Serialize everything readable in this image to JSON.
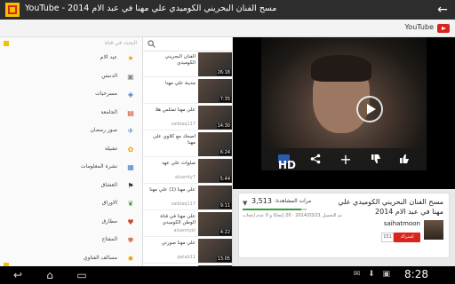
{
  "titlebar": {
    "title": "YouTube - مسح الفنان البحريني الكوميدي علي مهنا في عبد الام 2014",
    "back_icon": "arrow-back-icon"
  },
  "actionbar": {
    "label": "YouTube",
    "icon": "youtube-logo-icon",
    "brand_color": "#d9261c"
  },
  "sidebar": {
    "search_hint": "البحث في قناة",
    "items": [
      {
        "label": "عيد الام",
        "icon": "star-icon",
        "color": "#e6a400"
      },
      {
        "label": "الدنبس",
        "icon": "tv-icon",
        "color": "#888888"
      },
      {
        "label": "مسرحيات",
        "icon": "theater-icon",
        "color": "#4a7bc8"
      },
      {
        "label": "الجامعة",
        "icon": "building-icon",
        "color": "#c8452d"
      },
      {
        "label": "صور رمضان",
        "icon": "plane-icon",
        "color": "#4a7bc8"
      },
      {
        "label": "تشيلة",
        "icon": "flower-icon",
        "color": "#e6a400"
      },
      {
        "label": "نشرة المعلومات",
        "icon": "news-icon",
        "color": "#4a7bc8"
      },
      {
        "label": "العشاق",
        "icon": "heart-flag-icon",
        "color": "#333333"
      },
      {
        "label": "الاوراق",
        "icon": "leaf-icon",
        "color": "#3a9d3a"
      },
      {
        "label": "مطارق",
        "icon": "heart-icon",
        "color": "#c8452d"
      },
      {
        "label": "المفتاح",
        "icon": "flower-red-icon",
        "color": "#c8452d"
      },
      {
        "label": "مسالف الفتاوي",
        "icon": "sun-icon",
        "color": "#e6a400"
      }
    ]
  },
  "videolist": {
    "items": [
      {
        "title": "الفنان البحريني الكوميدي",
        "author": "",
        "duration": "26:18"
      },
      {
        "title": "مدينة علي مهنا",
        "author": "",
        "duration": "7:35"
      },
      {
        "title": "علي مهنا تمثلس هلا",
        "author": "saiblaq117",
        "duration": "14:30"
      },
      {
        "title": "اصحك مع كلاوي علي مهنا",
        "author": "",
        "duration": "6:24"
      },
      {
        "title": "صلوات علي عهد",
        "author": "alsamty7",
        "duration": "5:44"
      },
      {
        "title": "علي مهنا (1) علي مهنا",
        "author": "saiblaq117",
        "duration": "9:11"
      },
      {
        "title": "علي مهنا في قناة الوطن الكوميدي",
        "author": "alsamtybl",
        "duration": "4:22"
      },
      {
        "title": "علي مهنا صورتي",
        "author": "qatab11",
        "duration": "13:05"
      },
      {
        "title": "اضحك مع علي مهنا - الرقاد",
        "author": "alhamony",
        "duration": "9:40"
      }
    ]
  },
  "player": {
    "hd_label": "HD",
    "controls": [
      "hd-icon",
      "share-icon",
      "add-icon",
      "dislike-icon",
      "like-icon"
    ]
  },
  "info": {
    "video_title": "مسح الفنان البحريني الكوميدي علي مهنا في عبد الام 2014",
    "views_label": "مرات المشاهدة:",
    "views": "3,513",
    "expand_icon": "chevron-down-icon",
    "likes_fraction": 0.92,
    "meta": "تم التحميل 2014/03/21 · 20 إعجابًا و 0 عدم إعجاب",
    "channel": "saihatmoon",
    "subscribe_label": "اشتراك",
    "subscribe_count": "151"
  },
  "statusbar": {
    "time": "8:28",
    "nav_icons": [
      "back-nav-icon",
      "home-nav-icon",
      "recent-apps-icon"
    ]
  }
}
